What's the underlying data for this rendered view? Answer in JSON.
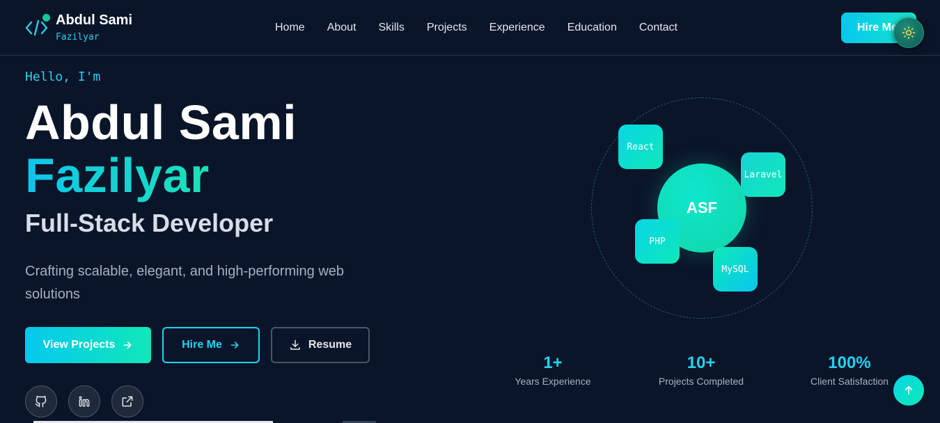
{
  "brand": {
    "name": "Abdul Sami",
    "subtitle": "Fazilyar",
    "icon": "code-brackets-icon"
  },
  "nav": {
    "items": [
      {
        "label": "Home"
      },
      {
        "label": "About"
      },
      {
        "label": "Skills"
      },
      {
        "label": "Projects"
      },
      {
        "label": "Experience"
      },
      {
        "label": "Education"
      },
      {
        "label": "Contact"
      }
    ],
    "hire_label": "Hire Me",
    "theme_icon": "sun-icon"
  },
  "hero": {
    "greeting": "Hello, I'm",
    "name_first": "Abdul Sami",
    "name_last": "Fazilyar",
    "role": "Full-Stack Developer",
    "tagline": "Crafting scalable, elegant, and high-performing web solutions",
    "buttons": {
      "view_projects": "View Projects",
      "hire_me": "Hire Me",
      "resume": "Resume"
    },
    "socials": [
      {
        "icon": "github-icon"
      },
      {
        "icon": "linkedin-icon"
      },
      {
        "icon": "external-link-icon"
      }
    ]
  },
  "graphic": {
    "center": "ASF",
    "tech": [
      "React",
      "Laravel",
      "PHP",
      "MySQL"
    ]
  },
  "stats": [
    {
      "value": "1+",
      "label": "Years Experience"
    },
    {
      "value": "10+",
      "label": "Projects Completed"
    },
    {
      "value": "100%",
      "label": "Client Satisfaction"
    }
  ],
  "colors": {
    "background": "#0b1529",
    "accent_cyan": "#22d3ee",
    "accent_green": "#10e8b8"
  }
}
